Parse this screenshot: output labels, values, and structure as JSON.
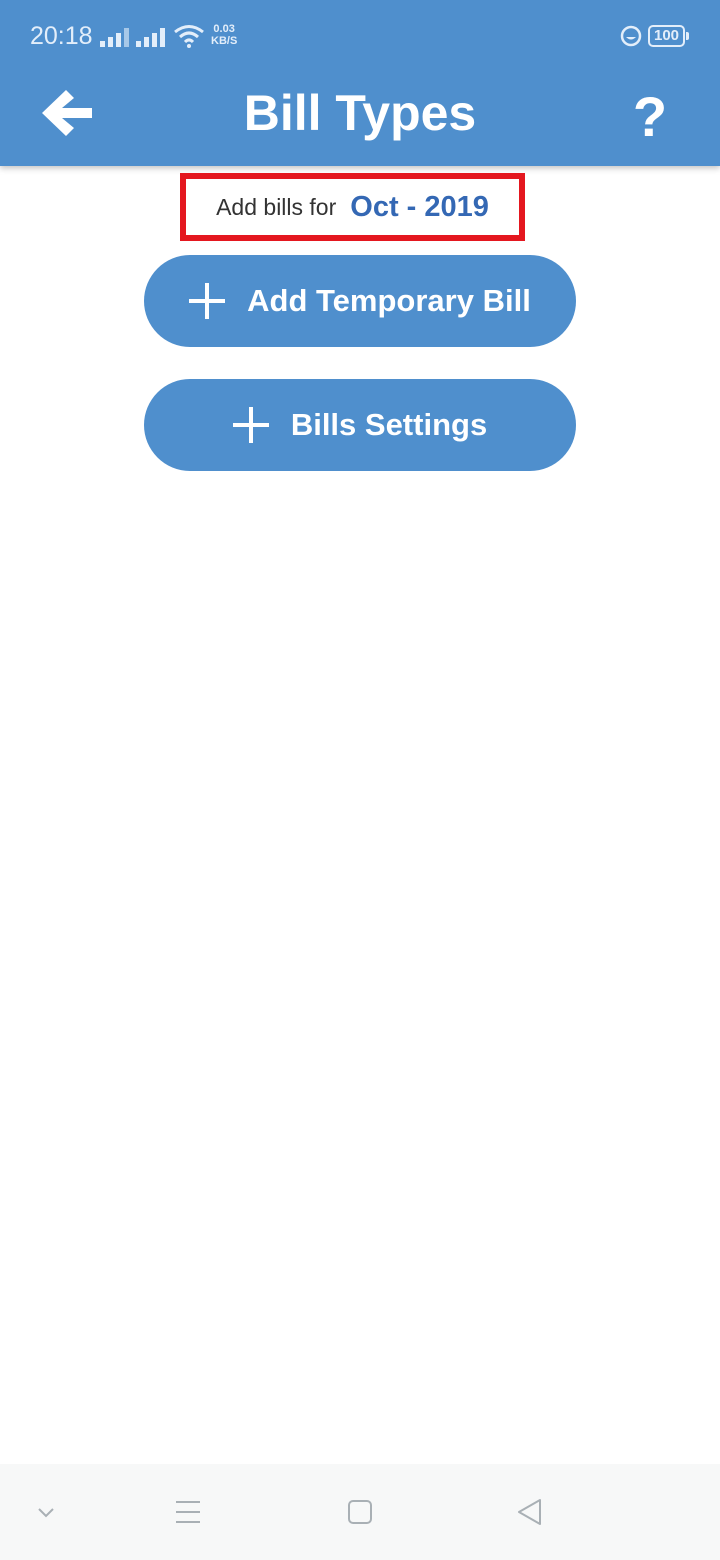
{
  "status_bar": {
    "time": "20:18",
    "network_speed_value": "0.03",
    "network_speed_unit": "KB/S",
    "battery": "100",
    "icons": [
      "signal-icon",
      "signal-icon",
      "wifi-icon",
      "moon-icon",
      "battery-icon"
    ]
  },
  "app_bar": {
    "title": "Bill Types",
    "help_label": "?",
    "back_icon": "arrow-left-icon"
  },
  "month_selector": {
    "label": "Add bills for",
    "value": "Oct - 2019"
  },
  "actions": {
    "add_temporary_bill": "Add Temporary Bill",
    "bills_settings": "Bills Settings",
    "icon": "plus-icon"
  },
  "nav_bar": {
    "icons": [
      "chevron-down-icon",
      "menu-icon",
      "home-square-icon",
      "back-triangle-icon"
    ]
  },
  "colors": {
    "primary": "#4f8fcd",
    "highlight_border": "#e4171f",
    "month_value": "#3468b4"
  }
}
